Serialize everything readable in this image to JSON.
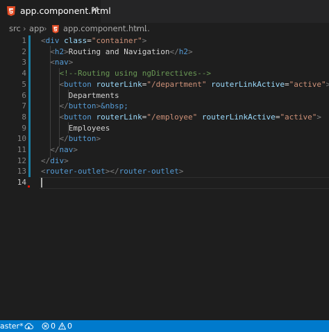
{
  "tab": {
    "file_icon": "html5-icon",
    "label": "app.component.html",
    "close_glyph": "✕"
  },
  "breadcrumb": {
    "items": [
      "src",
      "app",
      "app.component.html",
      "..."
    ],
    "separator": "›"
  },
  "editor": {
    "active_line": 14,
    "lines": [
      {
        "n": "1"
      },
      {
        "n": "2"
      },
      {
        "n": "3"
      },
      {
        "n": "4"
      },
      {
        "n": "5"
      },
      {
        "n": "6"
      },
      {
        "n": "7"
      },
      {
        "n": "8"
      },
      {
        "n": "9"
      },
      {
        "n": "10"
      },
      {
        "n": "11"
      },
      {
        "n": "12"
      },
      {
        "n": "13"
      },
      {
        "n": "14"
      }
    ],
    "tokens": {
      "l1": [
        "<",
        "div",
        " ",
        "class",
        "=",
        "\"container\"",
        ">"
      ],
      "l2": [
        "<",
        "h2",
        ">",
        "Routing and Navigation",
        "</",
        "h2",
        ">"
      ],
      "l3": [
        "<",
        "nav",
        ">"
      ],
      "l4": [
        "<!--Routing using ngDirectives-->"
      ],
      "l5": [
        "<",
        "button",
        " ",
        "routerLink",
        "=",
        "\"/department\"",
        " ",
        "routerLinkActive",
        "=",
        "\"active\"",
        ">"
      ],
      "l6": [
        "Departments"
      ],
      "l7": [
        "</",
        "button",
        ">",
        "&nbsp;"
      ],
      "l8": [
        "<",
        "button",
        " ",
        "routerLink",
        "=",
        "\"/employee\"",
        " ",
        "routerLinkActive",
        "=",
        "\"active\"",
        ">"
      ],
      "l9": [
        "Employees"
      ],
      "l10": [
        "</",
        "button",
        ">"
      ],
      "l11": [
        "</",
        "nav",
        ">"
      ],
      "l12": [
        "</",
        "div",
        ">"
      ],
      "l13": [
        "<",
        "router-outlet",
        "></",
        "router-outlet",
        ">"
      ]
    }
  },
  "statusbar": {
    "branch": "aster*",
    "sync_icon": "cloud-sync-icon",
    "errors": "0",
    "warnings": "0"
  },
  "colors": {
    "tag": "#569cd6",
    "attribute": "#9cdcfe",
    "string": "#ce9178",
    "comment": "#6a9955",
    "statusbar": "#007acc"
  }
}
